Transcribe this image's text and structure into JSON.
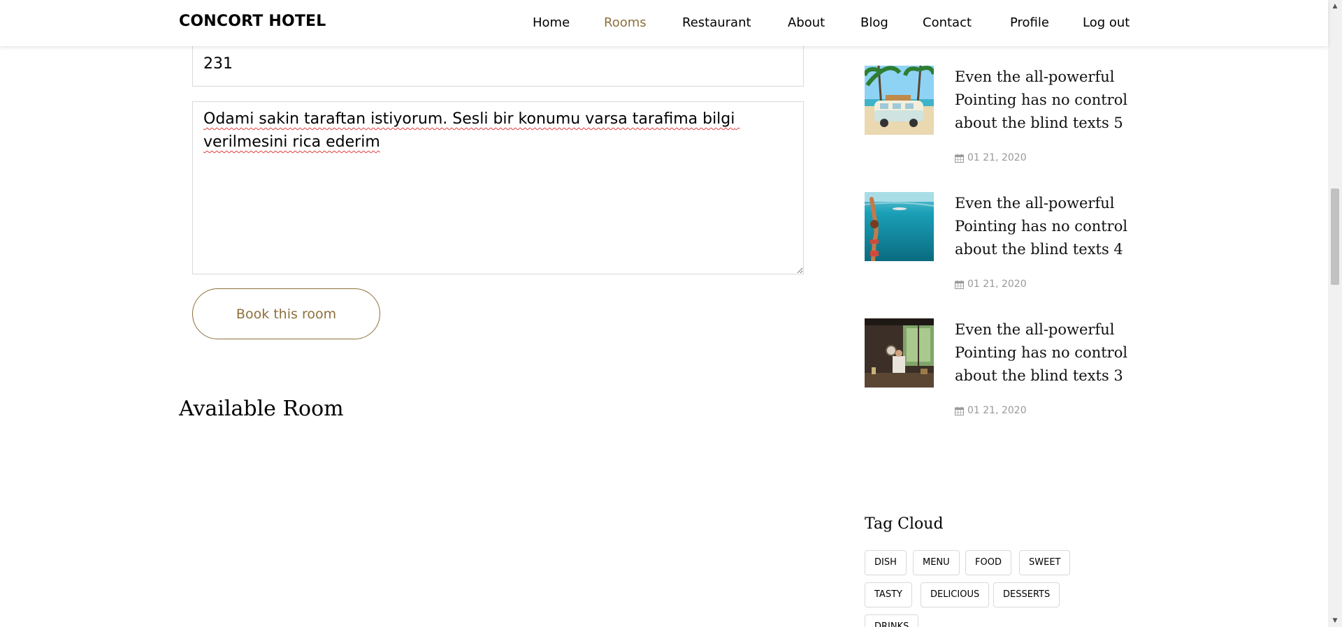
{
  "header": {
    "brand": "CONCORT HOTEL",
    "nav": [
      {
        "label": "Home"
      },
      {
        "label": "Rooms",
        "active": true
      },
      {
        "label": "Restaurant"
      },
      {
        "label": "About"
      },
      {
        "label": "Blog"
      },
      {
        "label": "Contact"
      },
      {
        "label": "Profile"
      },
      {
        "label": "Log out"
      }
    ]
  },
  "form": {
    "room_value": "231",
    "message_value": "Odami sakin taraftan istiyorum. Sesli bir konumu varsa tarafima bilgi verilmesini rica ederim",
    "book_button": "Book this room"
  },
  "main": {
    "available_title": "Available Room"
  },
  "sidebar": {
    "posts": [
      {
        "title": "Even the all-powerful Pointing has no control about the blind texts 5",
        "date": "01 21, 2020",
        "image": "van-beach"
      },
      {
        "title": "Even the all-powerful Pointing has no control about the blind texts 4",
        "date": "01 21, 2020",
        "image": "sea-swimmer"
      },
      {
        "title": "Even the all-powerful Pointing has no control about the blind texts 3",
        "date": "01 21, 2020",
        "image": "cafe-interior"
      }
    ],
    "tag_cloud": {
      "title": "Tag Cloud",
      "tags": [
        "DISH",
        "MENU",
        "FOOD",
        "SWEET",
        "TASTY",
        "DELICIOUS",
        "DESSERTS",
        "DRINKS"
      ]
    }
  },
  "colors": {
    "accent": "#8d703b",
    "border": "#d9d9d9",
    "meta_text": "#999999"
  }
}
